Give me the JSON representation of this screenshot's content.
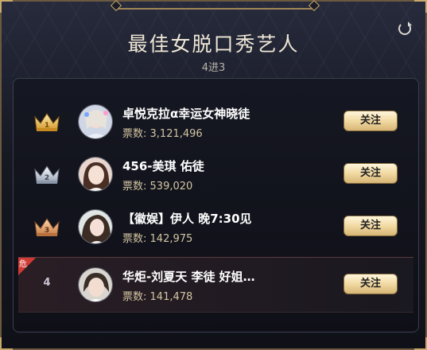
{
  "header": {
    "title": "最佳女脱口秀艺人",
    "subtitle": "4进3",
    "refresh_icon": "refresh-icon"
  },
  "colors": {
    "gold": "#c9a96a",
    "button_gold": "#f1d9a2",
    "danger_red": "#d03a35",
    "votes_text": "#d4c5a2"
  },
  "entries": [
    {
      "rank": 1,
      "rank_icon": "gold-crown-icon",
      "name": "卓悦克拉α幸运女神晓徒",
      "votes_prefix": "票数:",
      "votes": "3,121,496",
      "button": "关注"
    },
    {
      "rank": 2,
      "rank_icon": "silver-crown-icon",
      "name": "456-美琪 佑徒",
      "votes_prefix": "票数:",
      "votes": "539,020",
      "button": "关注"
    },
    {
      "rank": 3,
      "rank_icon": "bronze-crown-icon",
      "name": "【徽娱】伊人 晚7:30见",
      "votes_prefix": "票数:",
      "votes": "142,975",
      "button": "关注"
    },
    {
      "rank": "4",
      "danger_label": "危",
      "name": "华炬-刘夏天 李徒 好姐…",
      "votes_prefix": "票数:",
      "votes": "141,478",
      "button": "关注"
    }
  ]
}
